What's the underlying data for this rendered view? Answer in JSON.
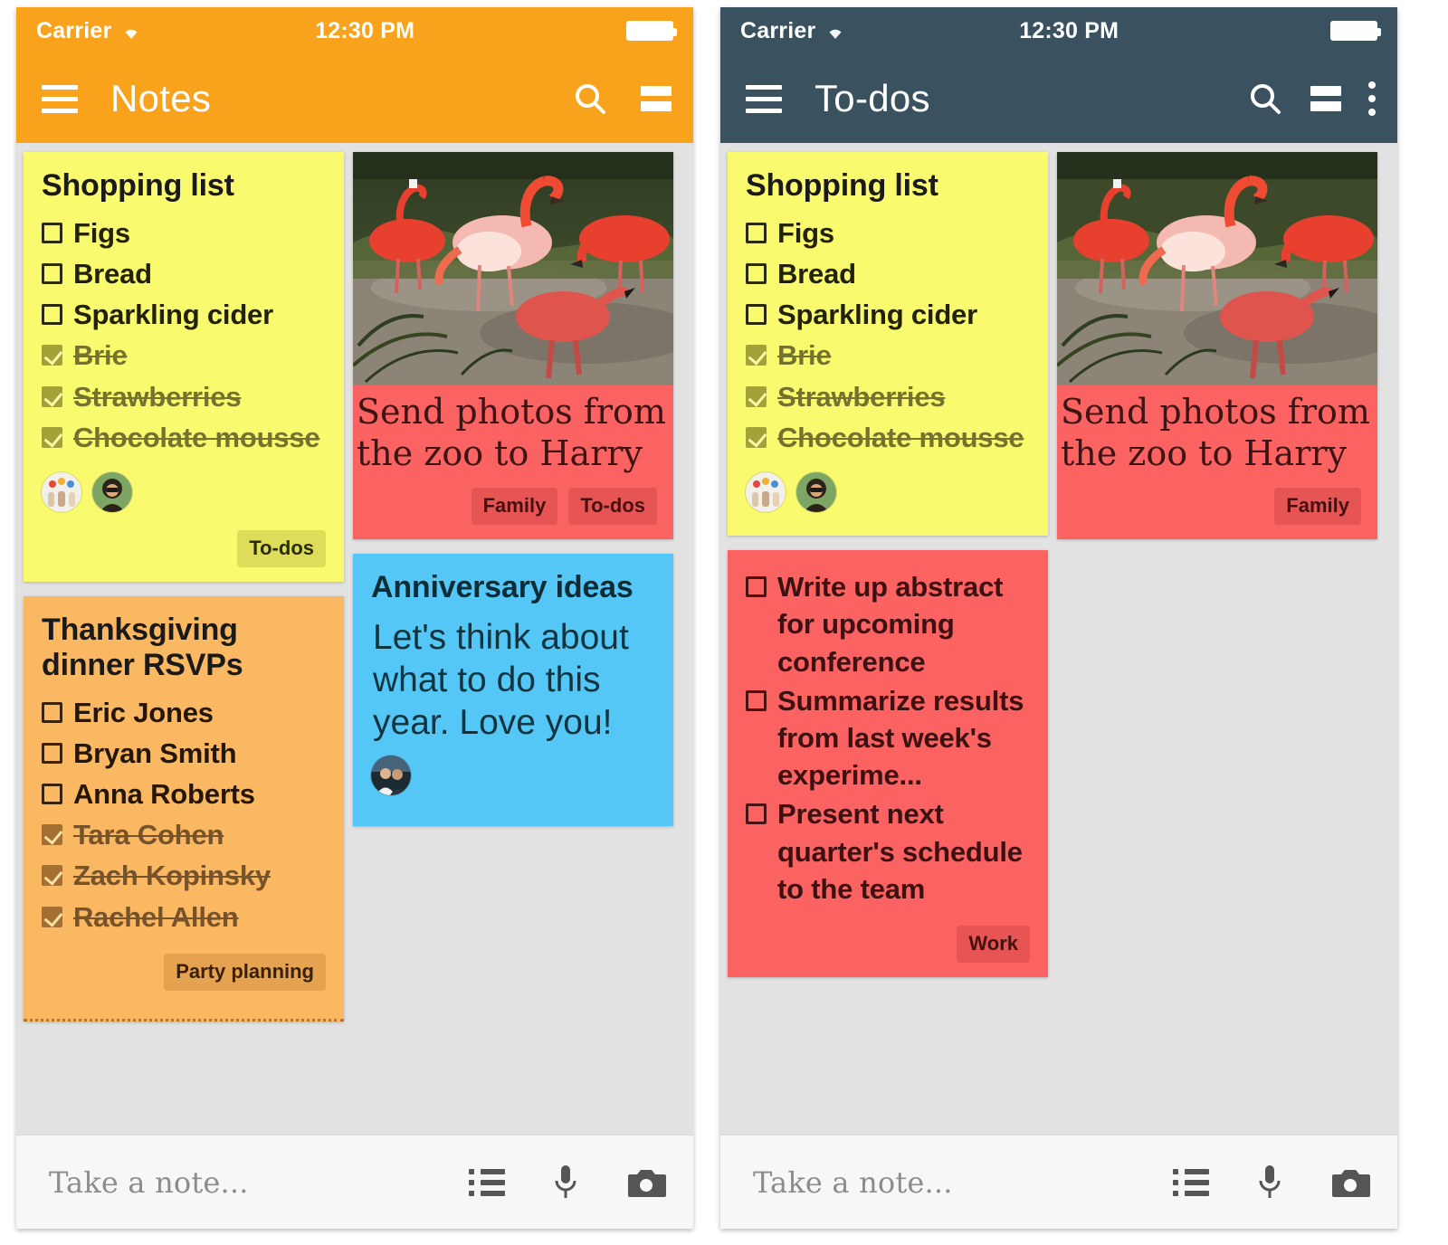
{
  "panels": [
    {
      "id": "notes",
      "accent": "#f9a21b",
      "statusbar": {
        "carrier": "Carrier",
        "time": "12:30 PM",
        "wifi_icon": "wifi-icon",
        "battery_icon": "battery-icon"
      },
      "appbar": {
        "title": "Notes",
        "menu_icon": "hamburger-menu-icon",
        "search_icon": "search-icon",
        "viewmode_icon": "list-view-toggle-icon",
        "overflow_icon": null
      },
      "notes": [
        {
          "id": "shopping-list",
          "color_name": "yellow",
          "color": "#fafa6e",
          "title": "Shopping list",
          "items": [
            {
              "label": "Figs",
              "checked": false
            },
            {
              "label": "Bread",
              "checked": false
            },
            {
              "label": "Sparkling cider",
              "checked": false
            },
            {
              "label": "Brie",
              "checked": true
            },
            {
              "label": "Strawberries",
              "checked": true
            },
            {
              "label": "Chocolate mousse",
              "checked": true
            }
          ],
          "collaborators": [
            "avatar-group-balloons",
            "avatar-woman-sunglasses"
          ],
          "tags": [
            "To-dos"
          ]
        },
        {
          "id": "thanksgiving-rsvps",
          "color_name": "amber",
          "color": "#fbb863",
          "title": "Thanksgiving dinner RSVPs",
          "items": [
            {
              "label": "Eric Jones",
              "checked": false
            },
            {
              "label": "Bryan Smith",
              "checked": false
            },
            {
              "label": "Anna Roberts",
              "checked": false
            },
            {
              "label": "Tara Cohen",
              "checked": true
            },
            {
              "label": "Zach Kopinsky",
              "checked": true
            },
            {
              "label": "Rachel Allen",
              "checked": true
            }
          ],
          "collaborators": [],
          "tags": [
            "Party planning"
          ],
          "cut_off": true
        },
        {
          "id": "send-photos-zoo",
          "color_name": "salmon",
          "color": "#fb6262",
          "photo": "flamingos-at-zoo-photo",
          "body": "Send photos from the zoo to Harry",
          "collaborators": [],
          "tags": [
            "Family",
            "To-dos"
          ]
        },
        {
          "id": "anniversary-ideas",
          "color_name": "blue",
          "color": "#55c7f7",
          "title": "Anniversary ideas",
          "body": "Let's think about what to do this year. Love you!",
          "collaborators": [
            "avatar-couple"
          ],
          "tags": []
        }
      ],
      "bottombar": {
        "placeholder": "Take a note...",
        "list_icon": "new-list-icon",
        "mic_icon": "microphone-icon",
        "camera_icon": "camera-icon"
      }
    },
    {
      "id": "todos",
      "accent": "#3a5160",
      "statusbar": {
        "carrier": "Carrier",
        "time": "12:30 PM",
        "wifi_icon": "wifi-icon",
        "battery_icon": "battery-icon"
      },
      "appbar": {
        "title": "To-dos",
        "menu_icon": "hamburger-menu-icon",
        "search_icon": "search-icon",
        "viewmode_icon": "list-view-toggle-icon",
        "overflow_icon": "overflow-menu-icon"
      },
      "notes": [
        {
          "id": "shopping-list",
          "color_name": "yellow",
          "color": "#fafa6e",
          "title": "Shopping list",
          "items": [
            {
              "label": "Figs",
              "checked": false
            },
            {
              "label": "Bread",
              "checked": false
            },
            {
              "label": "Sparkling cider",
              "checked": false
            },
            {
              "label": "Brie",
              "checked": true
            },
            {
              "label": "Strawberries",
              "checked": true
            },
            {
              "label": "Chocolate mousse",
              "checked": true
            }
          ],
          "collaborators": [
            "avatar-group-balloons",
            "avatar-woman-sunglasses"
          ],
          "tags": []
        },
        {
          "id": "work-tasks",
          "color_name": "salmon",
          "color": "#fb6262",
          "items": [
            {
              "label": "Write up abstract for upcoming conference",
              "checked": false
            },
            {
              "label": "Summarize results from last week's experime...",
              "checked": false
            },
            {
              "label": "Present next quarter's schedule to the team",
              "checked": false
            }
          ],
          "collaborators": [],
          "tags": [
            "Work"
          ]
        },
        {
          "id": "send-photos-zoo",
          "color_name": "salmon",
          "color": "#fb6262",
          "photo": "flamingos-at-zoo-photo",
          "body": "Send photos from the zoo to Harry",
          "collaborators": [],
          "tags": [
            "Family"
          ]
        }
      ],
      "bottombar": {
        "placeholder": "Take a note...",
        "list_icon": "new-list-icon",
        "mic_icon": "microphone-icon",
        "camera_icon": "camera-icon"
      }
    }
  ]
}
